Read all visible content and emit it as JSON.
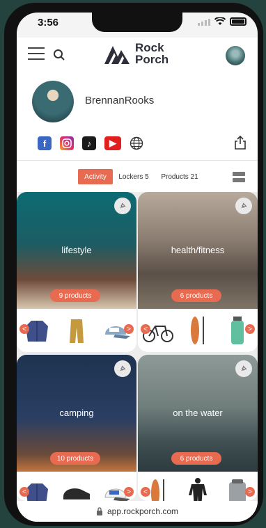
{
  "status": {
    "time": "3:56"
  },
  "header": {
    "logo_line1": "Rock",
    "logo_line2": "Porch"
  },
  "profile": {
    "username": "BrennanRooks"
  },
  "tabs": [
    {
      "label": "Activity",
      "active": true
    },
    {
      "label": "Lockers 5",
      "active": false
    },
    {
      "label": "Products 21",
      "active": false
    }
  ],
  "cards": [
    {
      "title": "lifestyle",
      "count": "9 products"
    },
    {
      "title": "health/fitness",
      "count": "6 products"
    },
    {
      "title": "camping",
      "count": "10 products"
    },
    {
      "title": "on the water",
      "count": "6 products"
    }
  ],
  "url": "app.rockporch.com",
  "colors": {
    "accent": "#e86a50",
    "brand": "#2d2f3a"
  }
}
